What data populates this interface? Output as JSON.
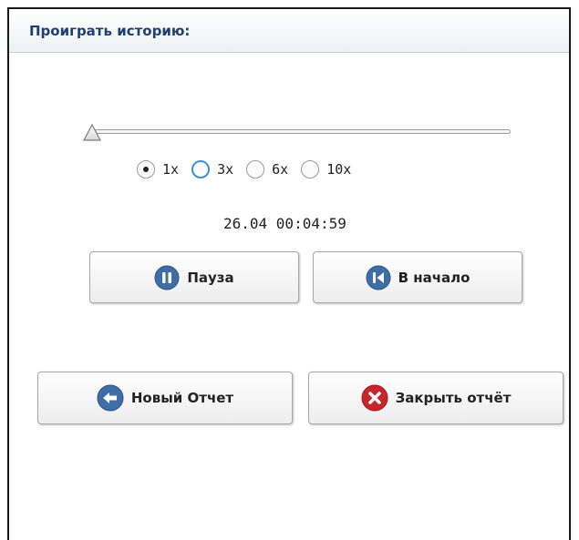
{
  "panel": {
    "title": "Проиграть историю:"
  },
  "playback": {
    "progress": 0,
    "speed_options": [
      "1x",
      "3x",
      "6x",
      "10x"
    ],
    "selected_speed": "1x",
    "time": "26.04 00:04:59"
  },
  "controls": {
    "pause_label": "Пауза",
    "restart_label": "В начало"
  },
  "actions": {
    "new_report_label": "Новый Отчет",
    "close_report_label": "Закрыть отчёт"
  },
  "colors": {
    "title_text": "#1f3f73",
    "icon_blue": "#3e6ea3",
    "icon_red": "#c8262b",
    "radio_hover": "#3d8ed8"
  },
  "icons": {
    "pause": "pause-circle-icon",
    "restart": "skip-to-start-icon",
    "new_report": "arrow-left-circle-icon",
    "close_report": "close-circle-icon"
  }
}
